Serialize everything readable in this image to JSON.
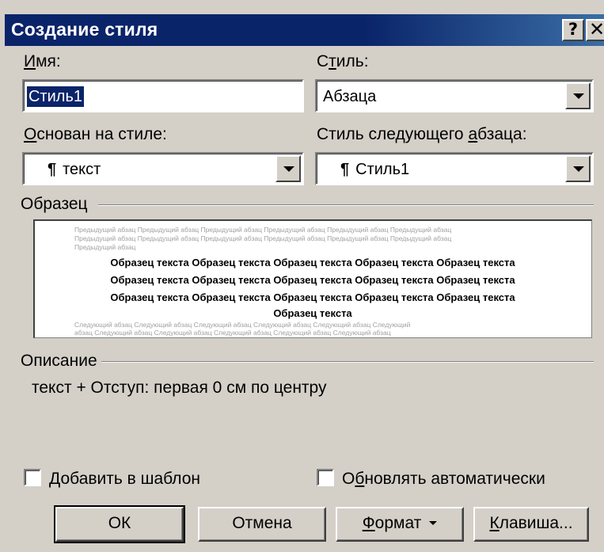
{
  "window": {
    "title": "Создание стиля",
    "help_glyph": "?",
    "close_glyph": "✕"
  },
  "name_field": {
    "label_accel": "И",
    "label_rest": "мя:",
    "value": "Стиль1"
  },
  "style_type": {
    "label_pre": "С",
    "label_accel": "т",
    "label_rest": "иль:",
    "value": "Абзаца"
  },
  "based_on": {
    "label_accel": "О",
    "label_rest": "снован на стиле:",
    "pilcrow": "¶",
    "value": "текст"
  },
  "next_style": {
    "label_pre": "Стиль следующего ",
    "label_accel": "а",
    "label_rest": "бзаца:",
    "pilcrow": "¶",
    "value": "Стиль1"
  },
  "sample": {
    "group_label": "Образец",
    "prev_lines": [
      "Предыдущий абзац Предыдущий абзац Предыдущий абзац Предыдущий абзац Предыдущий абзац Предыдущий абзац",
      "Предыдущий абзац Предыдущий абзац Предыдущий абзац Предыдущий абзац Предыдущий абзац Предыдущий абзац",
      "Предыдущий абзац"
    ],
    "sample_lines": [
      "Образец текста Образец текста Образец текста Образец текста Образец текста",
      "Образец текста Образец текста Образец текста Образец текста Образец текста",
      "Образец текста Образец текста Образец текста Образец текста Образец текста",
      "Образец текста"
    ],
    "next_lines": [
      "Следующий абзац Следующий абзац Следующий абзац Следующий абзац Следующий абзац Следующий",
      "абзац Следующий абзац Следующий абзац Следующий абзац Следующий абзац Следующий абзац"
    ]
  },
  "description": {
    "group_label": "Описание",
    "text": "текст + Отступ:  первая  0 см по центру"
  },
  "checkboxes": {
    "add_template": {
      "accel": "Д",
      "rest": "обавить в шаблон",
      "checked": false
    },
    "auto_update": {
      "pre": "О",
      "accel": "б",
      "rest": "новлять автоматически",
      "checked": false
    }
  },
  "buttons": {
    "ok": "ОК",
    "cancel": "Отмена",
    "format_accel": "Ф",
    "format_rest": "ормат",
    "shortcut_accel": "К",
    "shortcut_rest": "лавиша..."
  }
}
